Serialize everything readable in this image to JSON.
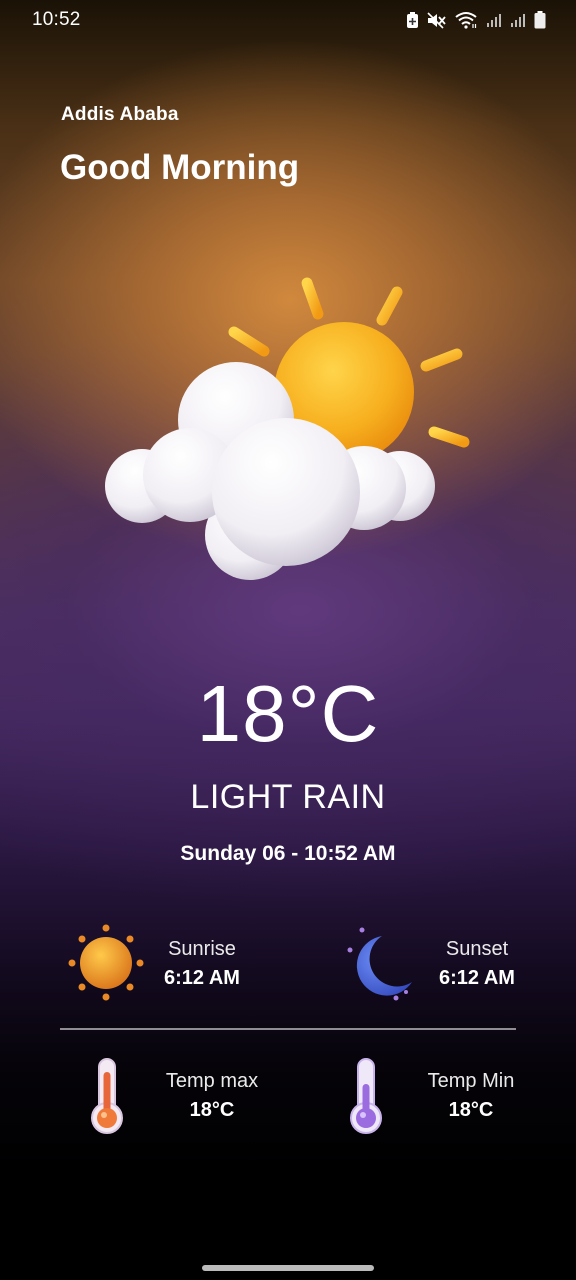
{
  "status_bar": {
    "time": "10:52",
    "icons": [
      "battery-saver-icon",
      "mute-icon",
      "wifi-icon",
      "signal-icon",
      "signal-icon",
      "battery-icon"
    ]
  },
  "location": {
    "city": "Addis Ababa"
  },
  "greeting": "Good Morning",
  "weather": {
    "icon": "sun-behind-cloud-icon",
    "temperature": "18°C",
    "condition": "LIGHT RAIN",
    "datetime": "Sunday 06 - 10:52 AM"
  },
  "stats": {
    "sunrise": {
      "label": "Sunrise",
      "value": "6:12 AM",
      "icon": "sun-icon"
    },
    "sunset": {
      "label": "Sunset",
      "value": "6:12 AM",
      "icon": "moon-icon"
    },
    "temp_max": {
      "label": "Temp max",
      "value": "18°C",
      "icon": "thermometer-hot-icon"
    },
    "temp_min": {
      "label": "Temp Min",
      "value": "18°C",
      "icon": "thermometer-cold-icon"
    }
  },
  "colors": {
    "sun": "#f5b323",
    "moon": "#4a6be0",
    "thermo_hot": "#e8673a",
    "thermo_cold": "#9b6be0",
    "bg_top": "#c9843e",
    "bg_mid": "#4e3260"
  }
}
